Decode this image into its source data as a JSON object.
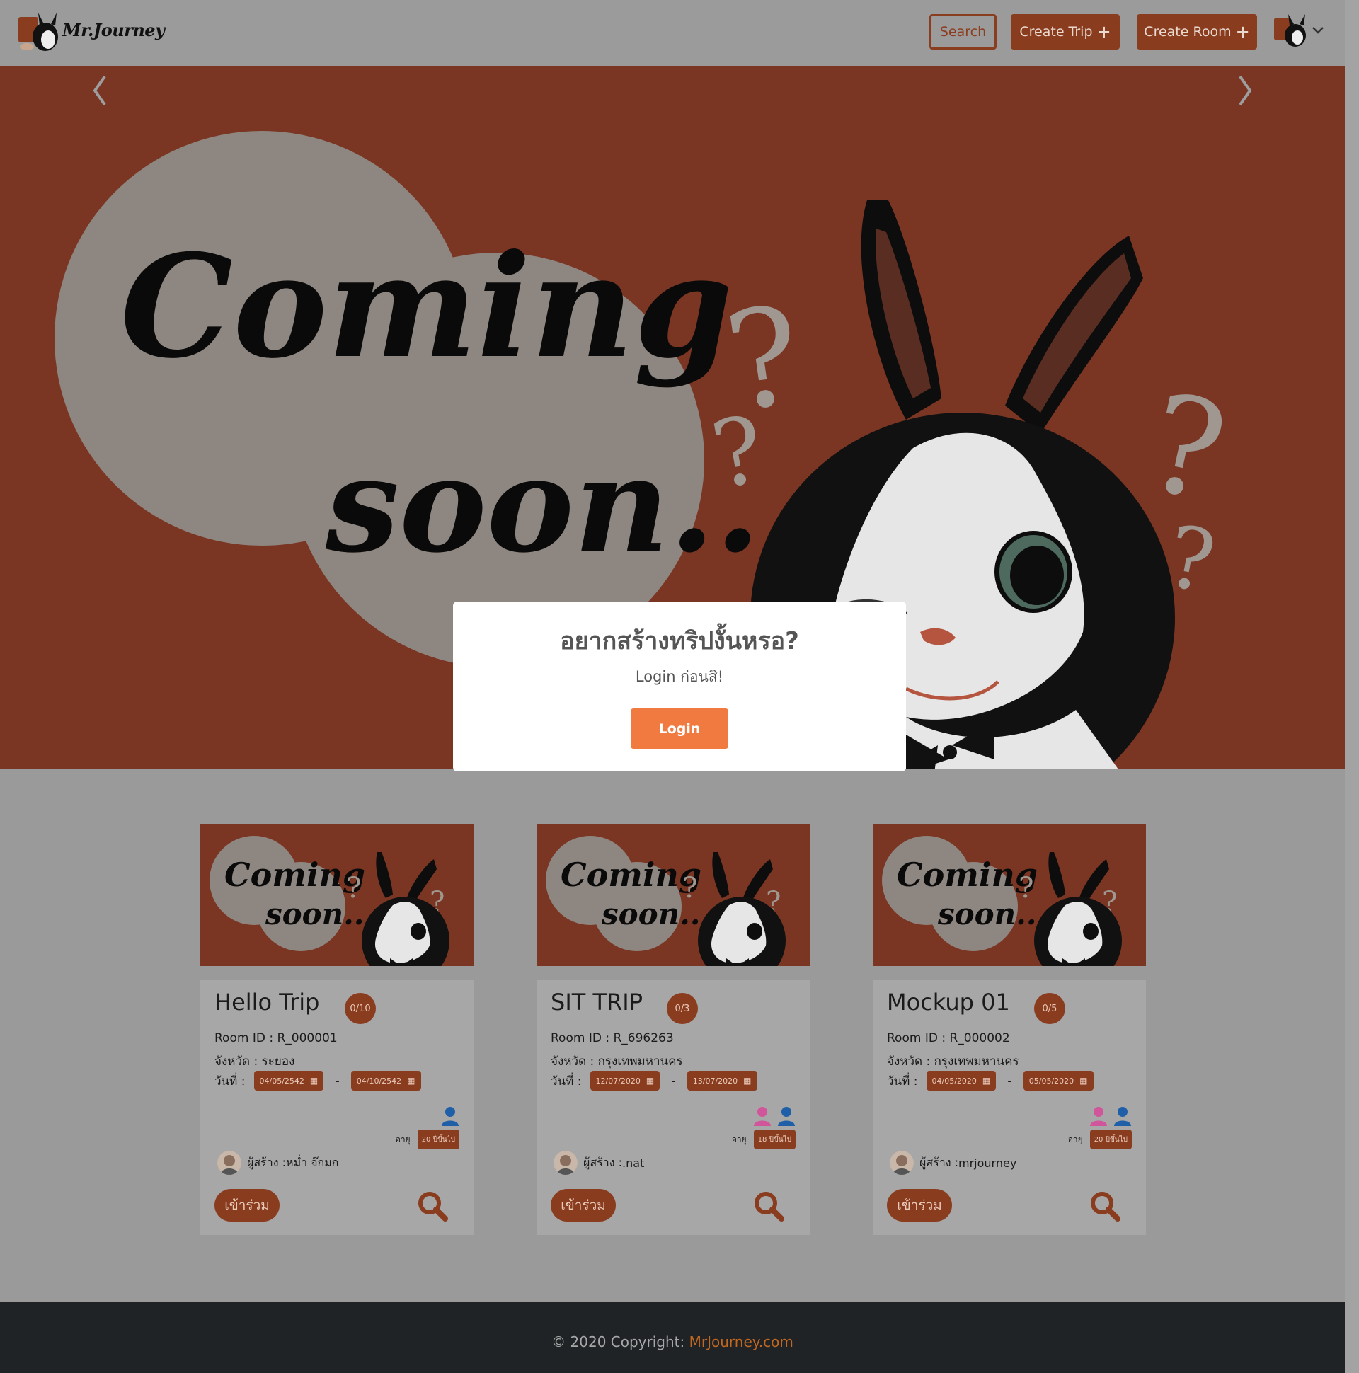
{
  "header": {
    "brand": "Mr.Journey",
    "search_label": "Search",
    "create_trip_label": "Create Trip",
    "create_room_label": "Create Room"
  },
  "modal": {
    "title": "อยากสร้างทริปงั้นหรอ?",
    "subtitle": "Login ก่อนสิ!",
    "button": "Login"
  },
  "banner": {
    "line1": "Coming",
    "line2": "soon.."
  },
  "labels": {
    "room_id": "Room ID : ",
    "province": "จังหวัด : ",
    "date": "วันที่ :",
    "age": "อายุ",
    "creator": "ผู้สร้าง : ",
    "join": "เข้าร่วม"
  },
  "cards": [
    {
      "title": "Hello Trip",
      "count": "0/10",
      "room_id": "R_000001",
      "province": "ระยอง",
      "start": "04/05/2542",
      "end": "04/10/2542",
      "age": "20 ปีขึ้นไป",
      "creator": "หม่ำ จ๊กมก",
      "genders": [
        "male"
      ]
    },
    {
      "title": "SIT TRIP",
      "count": "0/3",
      "room_id": "R_696263",
      "province": "กรุงเทพมหานคร",
      "start": "12/07/2020",
      "end": "13/07/2020",
      "age": "18 ปีขึ้นไป",
      "creator": ".nat",
      "genders": [
        "female",
        "male"
      ]
    },
    {
      "title": "Mockup 01",
      "count": "0/5",
      "room_id": "R_000002",
      "province": "กรุงเทพมหานคร",
      "start": "04/05/2020",
      "end": "05/05/2020",
      "age": "20 ปีขึ้นไป",
      "creator": "mrjourney",
      "genders": [
        "female",
        "male"
      ]
    }
  ],
  "footer": {
    "prefix": "© 2020 Copyright: ",
    "link": "MrJourney.com"
  },
  "colors": {
    "accent": "#8a3c1f",
    "hero_bg": "#7a3623",
    "login_button": "#f07a40",
    "male_icon": "#1f5fa8",
    "female_icon": "#d0559a"
  },
  "icons": [
    "rabbit-logo-icon",
    "plus-icon",
    "chevron-down-icon",
    "calendar-icon",
    "person-icon",
    "search-icon",
    "chevron-left-icon",
    "chevron-right-icon"
  ]
}
